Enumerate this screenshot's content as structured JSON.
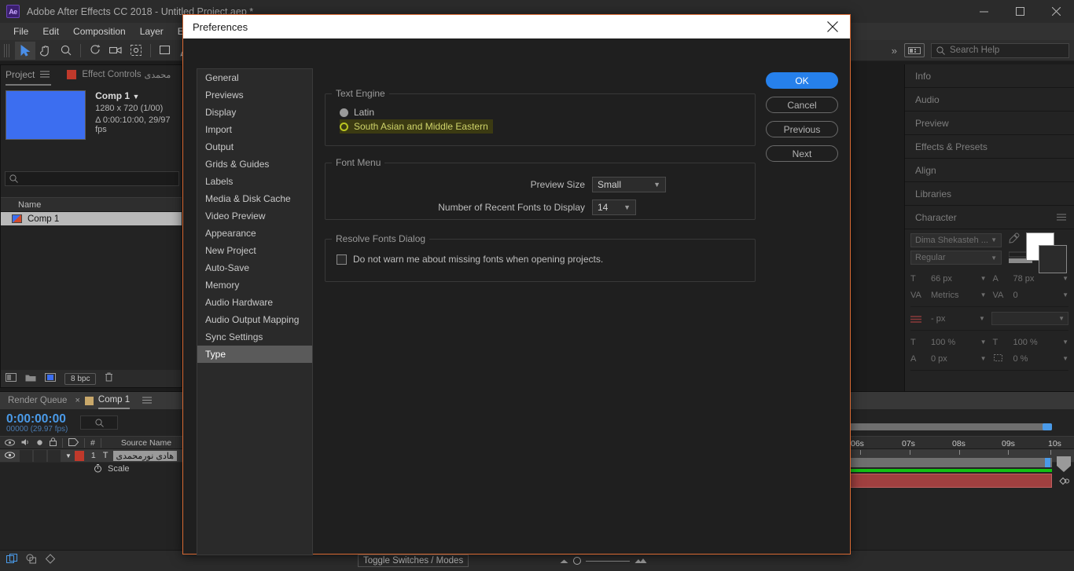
{
  "window": {
    "app_title": "Adobe After Effects CC 2018 - Untitled Project.aep *",
    "logo_text": "Ae",
    "minimize": "minimize-icon",
    "maximize": "maximize-icon",
    "close": "close-icon"
  },
  "menubar": {
    "items": [
      {
        "label": "File"
      },
      {
        "label": "Edit"
      },
      {
        "label": "Composition"
      },
      {
        "label": "Layer"
      },
      {
        "label": "Effect"
      }
    ]
  },
  "toolbar": {
    "tools": [
      {
        "name": "selection-tool",
        "active": true
      },
      {
        "name": "hand-tool",
        "active": false
      },
      {
        "name": "zoom-tool",
        "active": false
      },
      {
        "name": "rotation-tool",
        "active": false
      },
      {
        "name": "camera-tool",
        "active": false
      },
      {
        "name": "pan-behind-tool",
        "active": false
      },
      {
        "name": "shape-tool",
        "active": false
      },
      {
        "name": "pen-tool",
        "active": false
      }
    ],
    "overflow": "»",
    "search_placeholder": "Search Help"
  },
  "project_panel": {
    "tab_project": "Project",
    "tab_effect_controls": "Effect Controls",
    "tab_effect_controls_extra": "محمدى",
    "comp_name": "Comp 1",
    "comp_dimensions": "1280 x 720 (1/00)",
    "comp_duration": "Δ 0:00:10:00, 29/97 fps",
    "column_name": "Name",
    "item_name": "Comp 1",
    "bit_depth": "8 bpc"
  },
  "right_panels": {
    "rows": [
      {
        "label": "Info"
      },
      {
        "label": "Audio"
      },
      {
        "label": "Preview"
      },
      {
        "label": "Effects & Presets"
      },
      {
        "label": "Align"
      },
      {
        "label": "Libraries"
      },
      {
        "label": "Character"
      }
    ],
    "character": {
      "font_family": "Dima Shekasteh ...",
      "font_style": "Regular",
      "font_size": "66 px",
      "leading": "78 px",
      "kerning": "Metrics",
      "tracking": "0",
      "stroke_width": "- px",
      "vertical_scale": "100 %",
      "horizontal_scale": "100 %",
      "baseline_shift": "0 px",
      "tsume": "0 %"
    }
  },
  "timeline": {
    "tab_render_queue": "Render Queue",
    "tab_comp": "Comp 1",
    "timecode": "0:00:00:00",
    "timecode_sub": "00000 (29.97 fps)",
    "column_source_name": "Source Name",
    "column_hash": "#",
    "layer_number": "1",
    "layer_type": "T",
    "layer_name": "هادى نورمحمدى",
    "property_name": "Scale",
    "ruler_ticks": [
      "06s",
      "07s",
      "08s",
      "09s",
      "10s"
    ]
  },
  "status_bar": {
    "toggle_switches": "Toggle Switches / Modes"
  },
  "dialog": {
    "title": "Preferences",
    "close_icon": "close-icon",
    "sidebar": [
      {
        "label": "General",
        "selected": false
      },
      {
        "label": "Previews",
        "selected": false
      },
      {
        "label": "Display",
        "selected": false
      },
      {
        "label": "Import",
        "selected": false
      },
      {
        "label": "Output",
        "selected": false
      },
      {
        "label": "Grids & Guides",
        "selected": false
      },
      {
        "label": "Labels",
        "selected": false
      },
      {
        "label": "Media & Disk Cache",
        "selected": false
      },
      {
        "label": "Video Preview",
        "selected": false
      },
      {
        "label": "Appearance",
        "selected": false
      },
      {
        "label": "New Project",
        "selected": false
      },
      {
        "label": "Auto-Save",
        "selected": false
      },
      {
        "label": "Memory",
        "selected": false
      },
      {
        "label": "Audio Hardware",
        "selected": false
      },
      {
        "label": "Audio Output Mapping",
        "selected": false
      },
      {
        "label": "Sync Settings",
        "selected": false
      },
      {
        "label": "Type",
        "selected": true
      }
    ],
    "text_engine": {
      "legend": "Text Engine",
      "options": [
        {
          "label": "Latin",
          "state": "selected"
        },
        {
          "label": "South Asian and Middle Eastern",
          "state": "focused"
        }
      ]
    },
    "font_menu": {
      "legend": "Font Menu",
      "preview_size_label": "Preview Size",
      "preview_size_value": "Small",
      "recent_fonts_label": "Number of Recent Fonts to Display",
      "recent_fonts_value": "14"
    },
    "resolve_fonts": {
      "legend": "Resolve Fonts Dialog",
      "checkbox_label": "Do not warn me about missing fonts when opening projects.",
      "checked": false
    },
    "buttons": [
      {
        "label": "OK",
        "style": "primary"
      },
      {
        "label": "Cancel",
        "style": "ghost"
      },
      {
        "label": "Previous",
        "style": "ghost"
      },
      {
        "label": "Next",
        "style": "ghost"
      }
    ],
    "accent_color": "#2680eb",
    "border_color": "#d96a34",
    "focus_color": "#b9c421"
  }
}
